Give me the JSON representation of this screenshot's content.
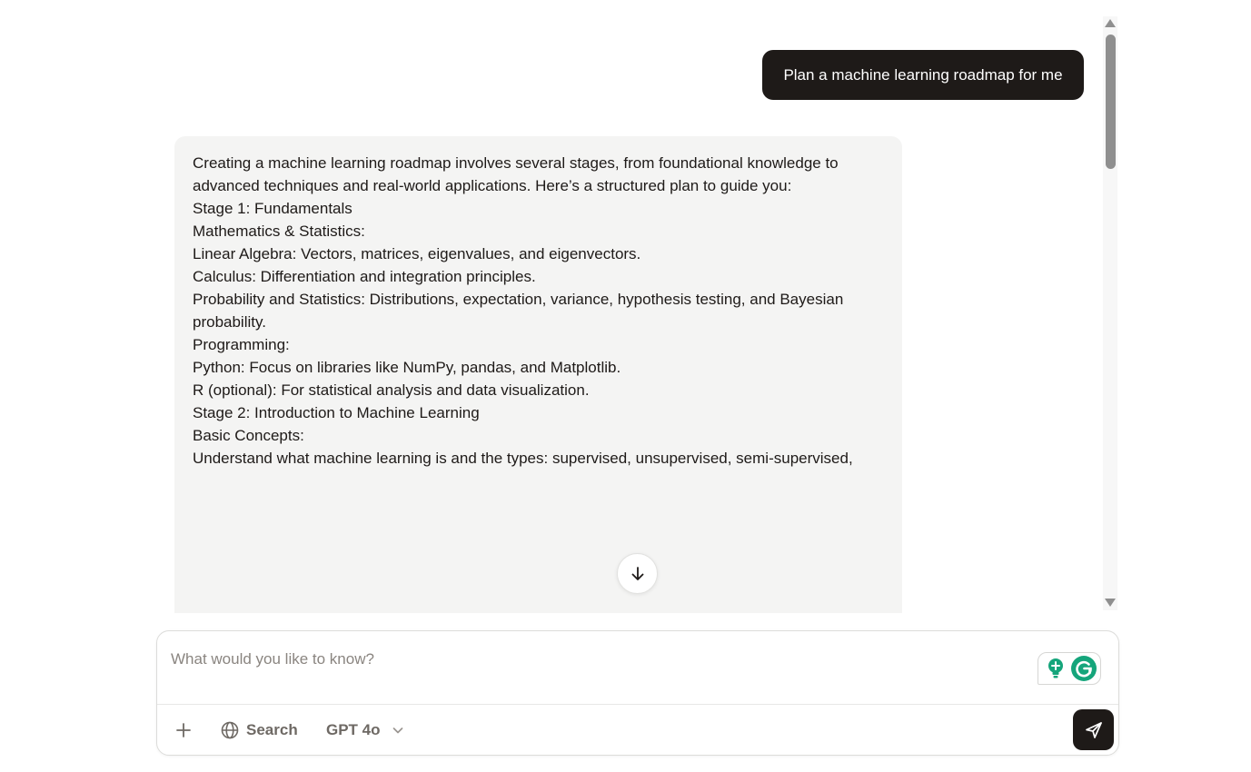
{
  "conversation": {
    "user_message": "Plan a machine learning roadmap for me",
    "assistant": {
      "intro": "Creating a machine learning roadmap involves several stages, from foundational knowledge to advanced techniques and real-world applications. Here’s a structured plan to guide you:",
      "stage1_heading": "Stage 1: Fundamentals",
      "math_label": "Mathematics & Statistics:",
      "math_items": [
        "Linear Algebra: Vectors, matrices, eigenvalues, and eigenvectors.",
        "Calculus: Differentiation and integration principles.",
        "Probability and Statistics: Distributions, expectation, variance, hypothesis testing, and Bayesian probability."
      ],
      "programming_label": "Programming:",
      "programming_items": [
        "Python: Focus on libraries like NumPy, pandas, and Matplotlib.",
        "R (optional): For statistical analysis and data visualization."
      ],
      "stage2_heading": "Stage 2: Introduction to Machine Learning",
      "basic_label": "Basic Concepts:",
      "basic_items": [
        "Understand what machine learning is and the types: supervised, unsupervised, semi-supervised,"
      ]
    }
  },
  "composer": {
    "placeholder": "What would you like to know?",
    "search_label": "Search",
    "model_label": "GPT 4o",
    "icons": {
      "attach": "plus-icon",
      "search": "globe-icon",
      "model": "chevron-down-icon",
      "send": "send-icon"
    }
  },
  "extensions": {
    "icons": [
      "lightbulb-icon",
      "grammarly-icon"
    ]
  },
  "colors": {
    "user_bubble": "#1e1a18",
    "assistant_bubble": "#f4f4f3",
    "send_button": "#1e1a18",
    "grammarly": "#15a57b"
  }
}
